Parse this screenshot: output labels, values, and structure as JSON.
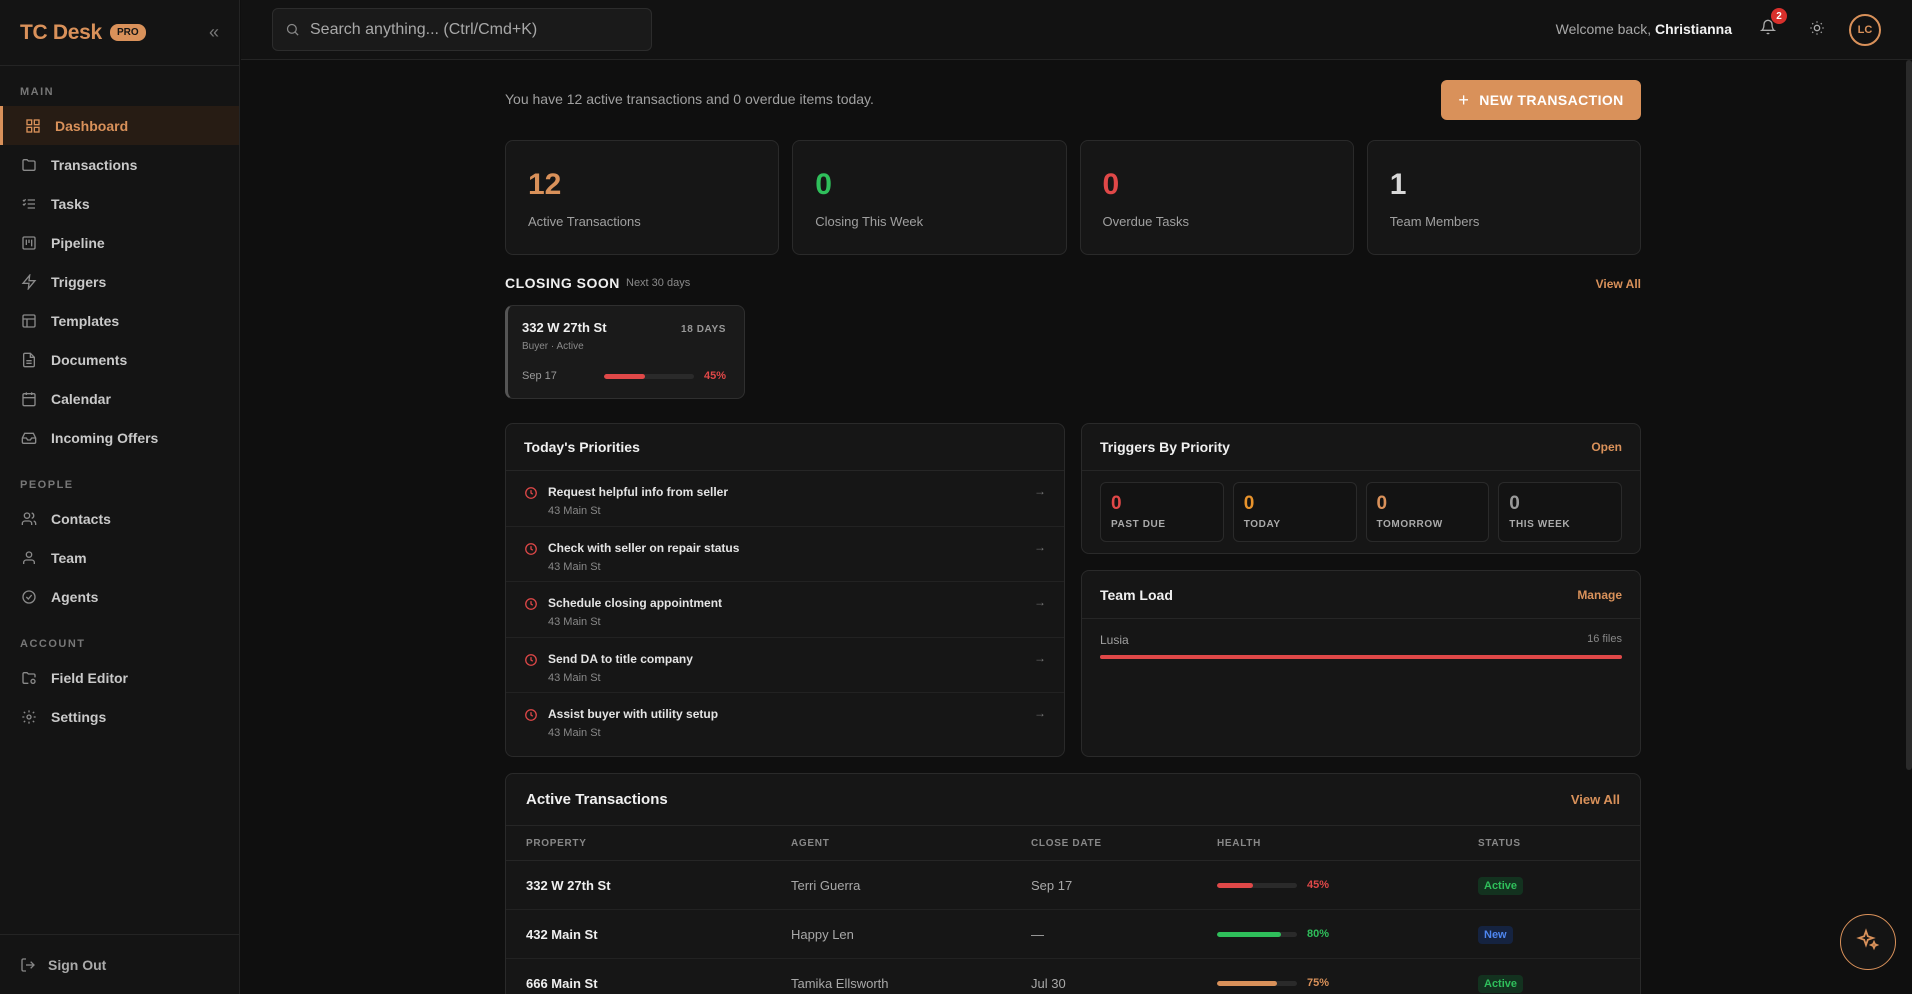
{
  "brand": {
    "name": "TC Desk",
    "badge": "PRO"
  },
  "sidebar": {
    "sections": [
      {
        "title": "MAIN"
      },
      {
        "title": "PEOPLE"
      },
      {
        "title": "ACCOUNT"
      }
    ],
    "items": [
      {
        "label": "Dashboard",
        "icon": "grid-icon",
        "active": true
      },
      {
        "label": "Transactions",
        "icon": "folder-icon"
      },
      {
        "label": "Tasks",
        "icon": "list-check-icon"
      },
      {
        "label": "Pipeline",
        "icon": "kanban-icon"
      },
      {
        "label": "Triggers",
        "icon": "zap-icon"
      },
      {
        "label": "Templates",
        "icon": "layout-icon"
      },
      {
        "label": "Documents",
        "icon": "file-icon"
      },
      {
        "label": "Calendar",
        "icon": "calendar-icon"
      },
      {
        "label": "Incoming Offers",
        "icon": "inbox-icon"
      },
      {
        "label": "Contacts",
        "icon": "users-icon"
      },
      {
        "label": "Team",
        "icon": "user-icon"
      },
      {
        "label": "Agents",
        "icon": "badge-check-icon"
      },
      {
        "label": "Field Editor",
        "icon": "folder-gear-icon"
      },
      {
        "label": "Settings",
        "icon": "gear-icon"
      }
    ],
    "signout": "Sign Out"
  },
  "topbar": {
    "search_placeholder": "Search anything... (Ctrl/Cmd+K)",
    "welcome_prefix": "Welcome back,",
    "user_name": "Christianna",
    "notifications": "2",
    "avatar_initials": "LC"
  },
  "intro": {
    "text": "You have 12 active transactions and 0 overdue items today.",
    "new_button": "NEW TRANSACTION"
  },
  "stats": [
    {
      "value": "12",
      "label": "Active Transactions",
      "color": "#d9915a"
    },
    {
      "value": "0",
      "label": "Closing This Week",
      "color": "#2fbf5b"
    },
    {
      "value": "0",
      "label": "Overdue Tasks",
      "color": "#e04848"
    },
    {
      "value": "1",
      "label": "Team Members",
      "color": "#d8d8d8"
    }
  ],
  "closing": {
    "title": "CLOSING SOON",
    "subtitle": "Next 30 days",
    "view_all": "View All",
    "card": {
      "address": "332 W 27th St",
      "days": "18 DAYS",
      "sub": "Buyer · Active",
      "date": "Sep 17",
      "progress": 45,
      "pct": "45%"
    }
  },
  "priorities": {
    "title": "Today's Priorities",
    "items": [
      {
        "title": "Request helpful info from seller",
        "sub": "43 Main St"
      },
      {
        "title": "Check with seller on repair status",
        "sub": "43 Main St"
      },
      {
        "title": "Schedule closing appointment",
        "sub": "43 Main St"
      },
      {
        "title": "Send DA to title company",
        "sub": "43 Main St"
      },
      {
        "title": "Assist buyer with utility setup",
        "sub": "43 Main St"
      }
    ]
  },
  "triggers": {
    "title": "Triggers By Priority",
    "link": "Open",
    "boxes": [
      {
        "value": "0",
        "label": "PAST DUE",
        "color": "#e04848"
      },
      {
        "value": "0",
        "label": "TODAY",
        "color": "#e8932c"
      },
      {
        "value": "0",
        "label": "TOMORROW",
        "color": "#d9915a"
      },
      {
        "value": "0",
        "label": "THIS WEEK",
        "color": "#9a9a9a"
      }
    ]
  },
  "team_load": {
    "title": "Team Load",
    "link": "Manage",
    "members": [
      {
        "name": "Lusia",
        "files": "16 files",
        "load": 100
      }
    ]
  },
  "active_transactions": {
    "title": "Active Transactions",
    "link": "View All",
    "columns": [
      "PROPERTY",
      "AGENT",
      "CLOSE DATE",
      "HEALTH",
      "STATUS"
    ],
    "rows": [
      {
        "property": "332 W 27th St",
        "agent": "Terri Guerra",
        "close": "Sep 17",
        "health": 45,
        "health_label": "45%",
        "health_color": "#e04848",
        "status": "Active",
        "status_class": "active"
      },
      {
        "property": "432 Main St",
        "agent": "Happy Len",
        "close": "—",
        "health": 80,
        "health_label": "80%",
        "health_color": "#2fbf5b",
        "status": "New",
        "status_class": "new"
      },
      {
        "property": "666 Main St",
        "agent": "Tamika Ellsworth",
        "close": "Jul 30",
        "health": 75,
        "health_label": "75%",
        "health_color": "#d9915a",
        "status": "Active",
        "status_class": "active"
      }
    ]
  },
  "fab_icon": "sparkle-icon"
}
